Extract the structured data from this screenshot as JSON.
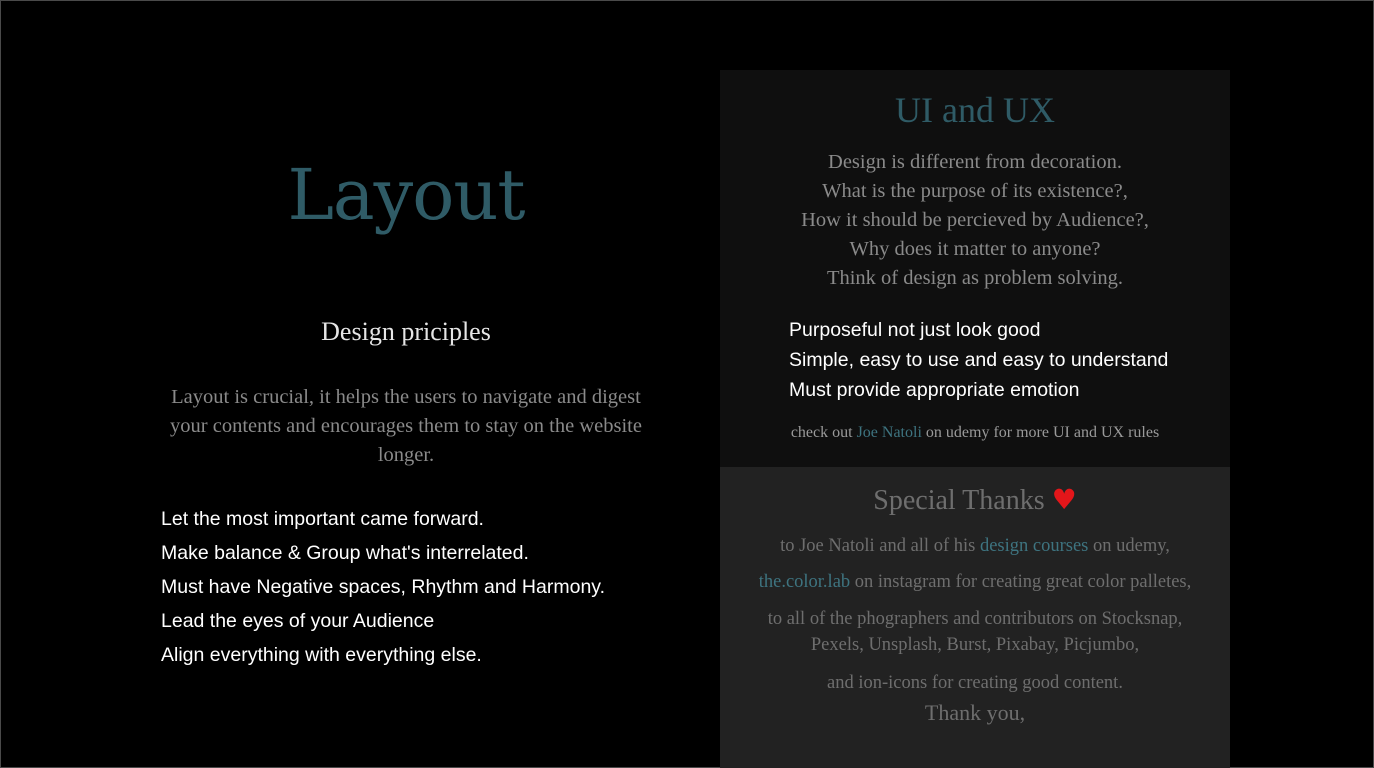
{
  "layout": {
    "title": "Layout",
    "subtitle": "Design priciples",
    "paragraph": "Layout is crucial, it helps the users to navigate and digest your contents and encourages them to stay on the website longer.",
    "principles": [
      "Let the most important came forward.",
      "Make balance & Group what's interrelated.",
      "Must have Negative spaces, Rhythm and Harmony.",
      "Lead the eyes of your Audience",
      "Align everything with everything else."
    ]
  },
  "ui_ux": {
    "title": "UI and UX",
    "paragraph_lines": [
      "Design is different from decoration.",
      "What is the purpose of its existence?,",
      "How it should be percieved by Audience?,",
      "Why does it matter to anyone?",
      "Think of design as problem solving."
    ],
    "rules": [
      "Purposeful not just look good",
      "Simple, easy to use and easy to understand",
      "Must provide appropriate emotion"
    ],
    "credit_prefix": "check out ",
    "credit_link": "Joe Natoli",
    "credit_suffix": " on udemy for more UI and UX rules"
  },
  "thanks": {
    "title": "Special Thanks ",
    "heart_icon": "heart-icon",
    "heart_glyph": "♥",
    "line1_prefix": "to Joe Natoli and all of his ",
    "line1_link": "design courses",
    "line1_suffix": " on udemy,",
    "line2_link": "the.color.lab",
    "line2_suffix": " on instagram for creating great color palletes,",
    "line3a": "to all of the phographers and contributors on Stocksnap,",
    "line3b": "Pexels, Unsplash, Burst, Pixabay, Picjumbo,",
    "line4": "and ion-icons for creating good content.",
    "final": "Thank you,"
  },
  "colors": {
    "background": "#000000",
    "accent_teal": "#2f5b66",
    "link_teal": "#3e7480",
    "heart_red": "#e3161a",
    "ui_panel": "#0f0f0f",
    "thanks_panel": "#222222"
  }
}
